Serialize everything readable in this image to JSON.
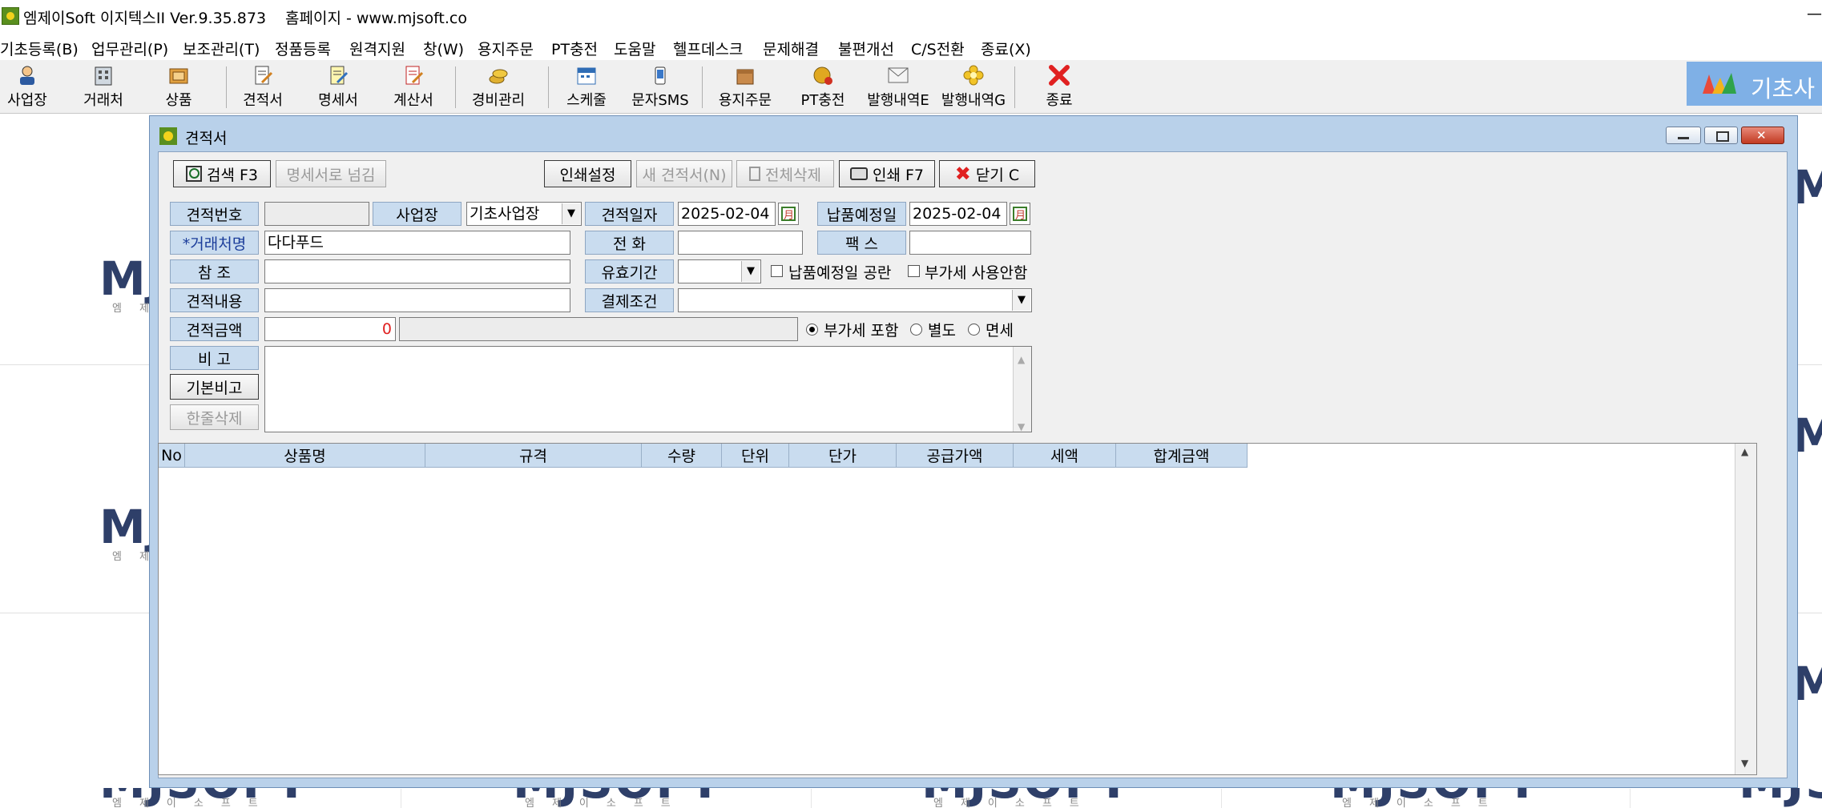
{
  "window": {
    "title": "엠제이Soft 이지텍스II Ver.9.35.873",
    "homepage": "홈페이지 - www.mjsoft.co",
    "minimize": "—"
  },
  "menu": [
    "기초등록(B)",
    "업무관리(P)",
    "보조관리(T)",
    "정품등록",
    "원격지원",
    "창(W)",
    "용지주문",
    "PT충전",
    "도움말",
    "헬프데스크",
    "문제해결",
    "불편개선",
    "C/S전환",
    "종료(X)"
  ],
  "toolbar": [
    {
      "label": "사업장",
      "icon": "business-user-icon"
    },
    {
      "label": "거래처",
      "icon": "building-icon"
    },
    {
      "label": "상품",
      "icon": "box-icon"
    },
    {
      "label": "견적서",
      "icon": "quote-doc-icon"
    },
    {
      "label": "명세서",
      "icon": "statement-doc-icon"
    },
    {
      "label": "계산서",
      "icon": "invoice-doc-icon"
    },
    {
      "label": "경비관리",
      "icon": "coins-icon"
    },
    {
      "label": "스케줄",
      "icon": "calendar-icon"
    },
    {
      "label": "문자SMS",
      "icon": "phone-sms-icon"
    },
    {
      "label": "용지주문",
      "icon": "paper-box-icon"
    },
    {
      "label": "PT충전",
      "icon": "coin-charge-icon"
    },
    {
      "label": "발행내역E",
      "icon": "envelope-icon"
    },
    {
      "label": "발행내역G",
      "icon": "flower-icon"
    },
    {
      "label": "종료",
      "icon": "red-x-icon"
    }
  ],
  "banner": {
    "label": "기초사"
  },
  "watermark": {
    "text": "MJSOFT",
    "sub": "엠제이소프트"
  },
  "dialog": {
    "title": "견적서",
    "buttons": {
      "search": "검색 F3",
      "to_statement": "명세서로 넘김",
      "print_settings": "인쇄설정",
      "new_quote": "새 견적서(N)",
      "delete_all": "전체삭제",
      "print": "인쇄 F7",
      "close": "닫기 C"
    },
    "labels": {
      "quote_no": "견적번호",
      "workplace": "사업장",
      "quote_date": "견적일자",
      "delivery_date": "납품예정일",
      "client": "*거래처명",
      "phone": "전      화",
      "fax": "팩      스",
      "reference": "참      조",
      "validity": "유효기간",
      "content": "견적내용",
      "payment": "결제조건",
      "amount": "견적금액",
      "memo": "비      고",
      "default_memo": "기본비고",
      "delete_line": "한줄삭제"
    },
    "values": {
      "quote_no": "",
      "workplace": "기초사업장",
      "quote_date": "2025-02-04",
      "delivery_date": "2025-02-04",
      "client": "다다푸드",
      "phone": "",
      "fax": "",
      "reference": "",
      "validity": "",
      "content": "",
      "payment": "",
      "amount": "0",
      "amount_words": "",
      "memo": ""
    },
    "checks": {
      "delivery_blank": "납품예정일 공란",
      "no_vat": "부가세 사용안함"
    },
    "vat_options": [
      "부가세 포함",
      "별도",
      "면세"
    ],
    "vat_selected": "부가세 포함",
    "grid_columns": [
      "No",
      "상품명",
      "규격",
      "수량",
      "단위",
      "단가",
      "공급가액",
      "세액",
      "합계금액"
    ]
  }
}
